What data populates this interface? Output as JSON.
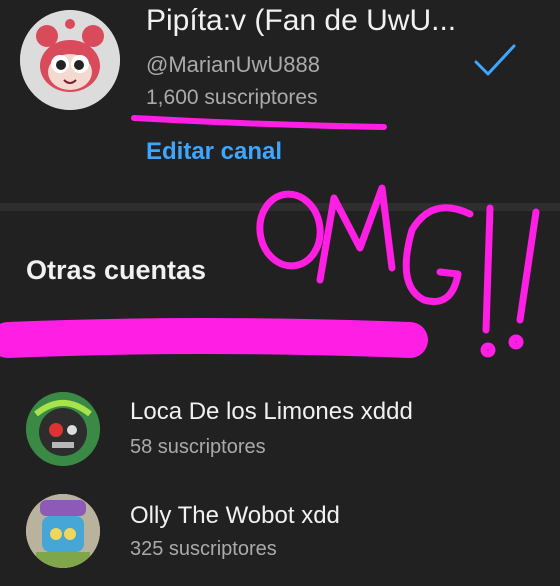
{
  "current_account": {
    "name": "Pipíta:v (Fan de UwU...",
    "handle": "@MarianUwU888",
    "subscribers": "1,600 suscriptores",
    "edit_label": "Editar canal",
    "check_icon": "checkmark-icon",
    "accent_color": "#3ea6ff"
  },
  "other_accounts": {
    "heading": "Otras cuentas",
    "items": [
      {
        "name": "Loca De los Limones xddd",
        "subscribers": "58 suscriptores",
        "avatar_icon": "robot-avatar-icon"
      },
      {
        "name": "Olly The Wobot xdd",
        "subscribers": "325 suscriptores",
        "avatar_icon": "bot-avatar-icon"
      }
    ]
  },
  "annotations": {
    "handwriting": "OMG!!",
    "marker_color": "#ff1ee3"
  }
}
